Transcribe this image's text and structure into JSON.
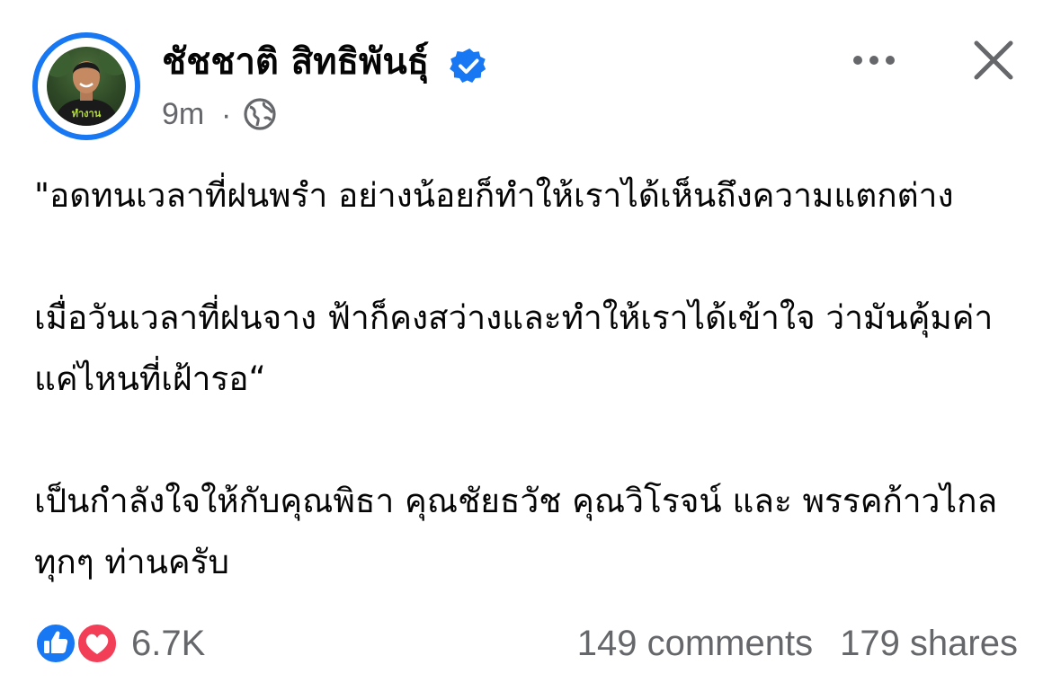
{
  "post": {
    "author_name": "ชัชชาติ สิทธิพันธุ์",
    "verified": true,
    "time": "9m",
    "separator": "·",
    "audience_icon": "globe-icon",
    "menu_icon": "more-horizontal-icon",
    "close_icon": "close-icon",
    "avatar_shirt_text": "ทำงาน"
  },
  "content": {
    "paragraphs": [
      "\"อดทนเวลาที่ฝนพรำ อย่างน้อยก็ทำให้เราได้เห็นถึงความแตกต่าง",
      "เมื่อวันเวลาที่ฝนจาง ฟ้าก็คงสว่างและทำให้เราได้เข้าใจ ว่ามันคุ้มค่าแค่ไหนที่เฝ้ารอ“",
      "เป็นกำลังใจให้กับคุณพิธา คุณชัยธวัช คุณวิโรจน์ และ พรรคก้าวไกลทุกๆ ท่านครับ"
    ]
  },
  "engagement": {
    "reaction_icons": [
      "like-icon",
      "love-icon"
    ],
    "reaction_count": "6.7K",
    "comments": "149 comments",
    "shares": "179 shares"
  },
  "colors": {
    "brand_blue": "#1877f2",
    "love_red": "#f33e58",
    "secondary_text": "#65676b",
    "primary_text": "#050505"
  }
}
